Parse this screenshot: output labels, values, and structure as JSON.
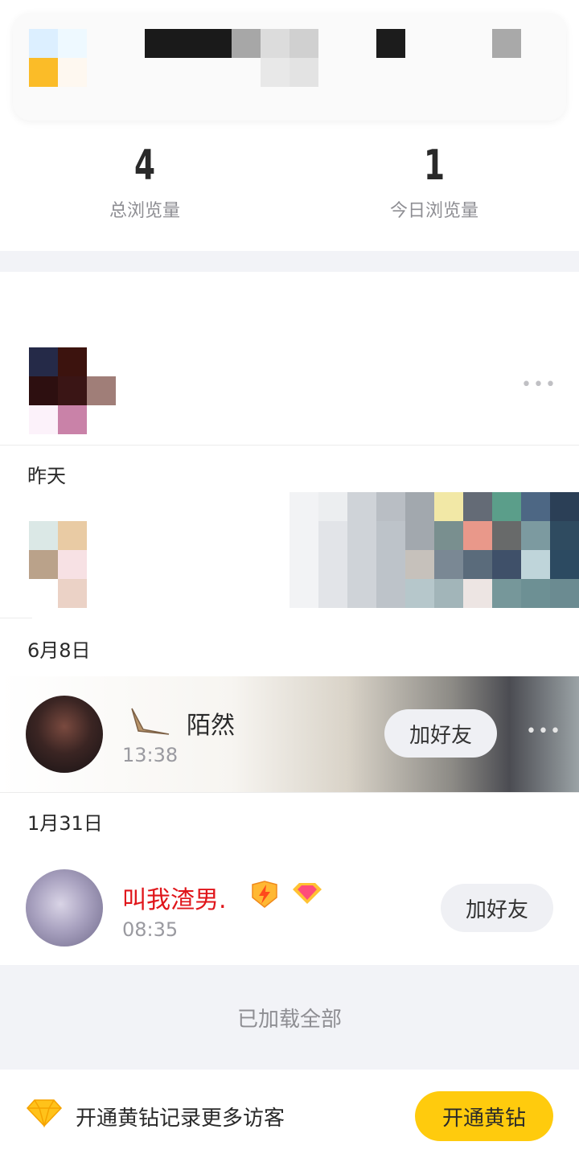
{
  "stats": {
    "total_views_value": "4",
    "total_views_label": "总浏览量",
    "today_views_value": "1",
    "today_views_label": "今日浏览量"
  },
  "sections": [
    {
      "date": "昨天"
    },
    {
      "date": "6月8日"
    },
    {
      "date": "1月31日"
    }
  ],
  "visitors": [
    {
      "name": "陌然",
      "time": "13:38",
      "action": "加好友"
    },
    {
      "name": "叫我渣男.",
      "time": "08:35",
      "action": "加好友",
      "name_color": "#e0161b"
    }
  ],
  "loaded_all": "已加载全部",
  "footer": {
    "promo_text": "开通黄钻记录更多访客",
    "vip_button": "开通黄钻"
  },
  "colors": {
    "accent_yellow": "#ffcb0d",
    "vip_name_red": "#e0161b",
    "background_gray": "#f2f3f7"
  }
}
